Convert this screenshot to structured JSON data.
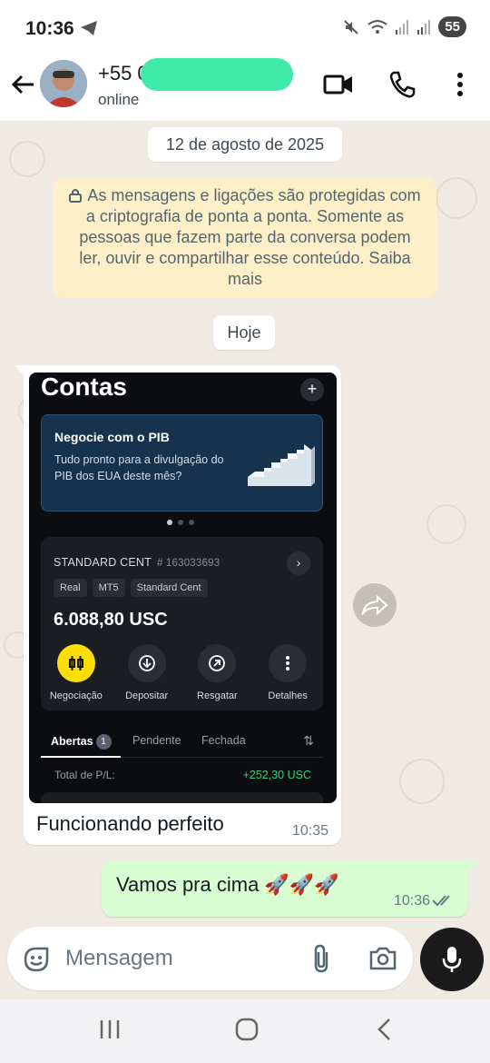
{
  "status_bar": {
    "time": "10:36",
    "battery": "55",
    "icons": [
      "telegram-icon",
      "mute-icon",
      "wifi-icon",
      "signal-icon",
      "signal-icon"
    ]
  },
  "header": {
    "contact_name": "+55 0",
    "contact_status": "online",
    "icons": [
      "back-arrow-icon",
      "video-call-icon",
      "phone-call-icon",
      "more-vert-icon"
    ]
  },
  "chat": {
    "date_chip": "12 de agosto de 2025",
    "encryption_notice": "As mensagens e ligações são protegidas com a criptografia de ponta a ponta. Somente as pessoas que fazem parte da conversa podem ler, ouvir e compartilhar esse conteúdo. Saiba mais",
    "today_chip": "Hoje",
    "incoming": {
      "caption": "Funcionando perfeito",
      "time": "10:35",
      "screenshot": {
        "title": "Contas",
        "plus": "+",
        "promo_title": "Negocie com o PIB",
        "promo_text": "Tudo pronto para a divulgação do PIB dos EUA deste mês?",
        "account_name": "STANDARD CENT",
        "account_number": "# 163033693",
        "tags": [
          "Real",
          "MT5",
          "Standard Cent"
        ],
        "balance": "6.088,80 USC",
        "actions": [
          {
            "label": "Negociação",
            "icon": "candles-icon"
          },
          {
            "label": "Depositar",
            "icon": "deposit-icon"
          },
          {
            "label": "Resgatar",
            "icon": "withdraw-icon"
          },
          {
            "label": "Detalhes",
            "icon": "more-vert-icon"
          }
        ],
        "tabs": [
          "Abertas",
          "Pendente",
          "Fechada"
        ],
        "open_count": "1",
        "pl_label": "Total de P/L:",
        "pl_value": "+252,30 USC",
        "accent_yellow": "#ffde02",
        "accent_green": "#2ed47a"
      }
    },
    "outgoing": {
      "text": "Vamos pra cima 🚀🚀🚀",
      "time": "10:36",
      "status": "read"
    }
  },
  "composer": {
    "placeholder": "Mensagem",
    "icons": [
      "sticker-icon",
      "attach-icon",
      "camera-icon",
      "mic-icon"
    ]
  },
  "navbar": {
    "icons": [
      "recents-icon",
      "home-icon",
      "back-icon"
    ]
  },
  "colors": {
    "wallpaper": "#efeae2",
    "outgoing_bubble": "#d9fdd3",
    "encryption_bg": "#fdf0c8",
    "name_mask": "#3fe9a8"
  }
}
